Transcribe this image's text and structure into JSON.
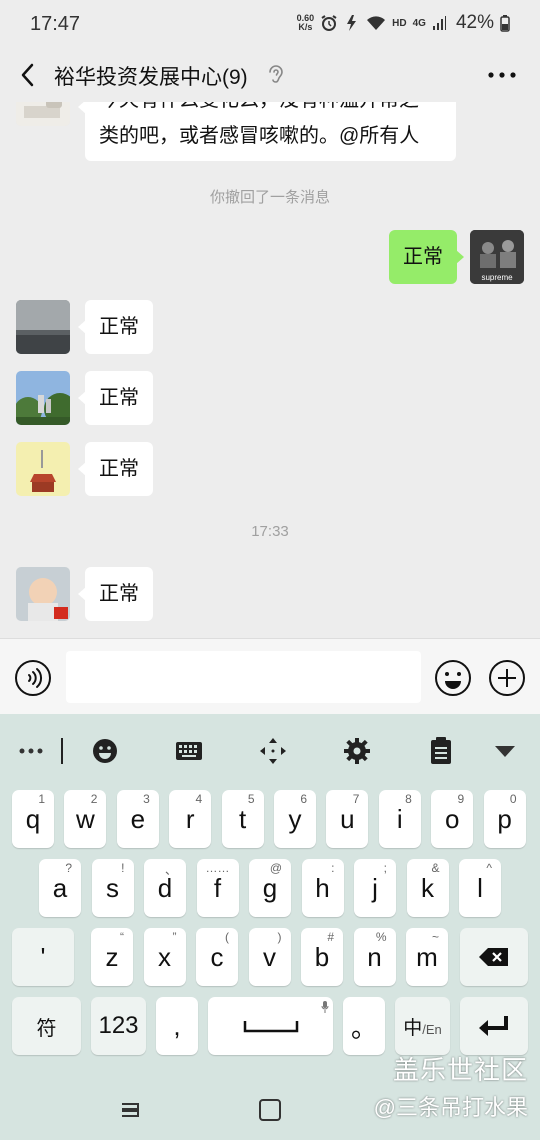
{
  "status_bar": {
    "time": "17:47",
    "net_speed_value": "0.60",
    "net_speed_unit": "K/s",
    "network_label": "HD",
    "signal_label": "4G",
    "battery": "42%"
  },
  "header": {
    "title": "裕华投资发展中心(9)"
  },
  "messages": {
    "partial_line1": "今天有什么变化么，没有种温开帮之",
    "partial_line2": "类的吧，或者感冒咳嗽的。@所有人",
    "recall_notice": "你撤回了一条消息",
    "my_reply": "正常",
    "my_avatar_caption": "supreme",
    "reply1": "正常",
    "reply2": "正常",
    "reply3": "正常",
    "timestamp": "17:33",
    "reply4": "正常"
  },
  "input_bar": {
    "placeholder": ""
  },
  "keyboard": {
    "row1": [
      {
        "key": "q",
        "sub": "1"
      },
      {
        "key": "w",
        "sub": "2"
      },
      {
        "key": "e",
        "sub": "3"
      },
      {
        "key": "r",
        "sub": "4"
      },
      {
        "key": "t",
        "sub": "5"
      },
      {
        "key": "y",
        "sub": "6"
      },
      {
        "key": "u",
        "sub": "7"
      },
      {
        "key": "i",
        "sub": "8"
      },
      {
        "key": "o",
        "sub": "9"
      },
      {
        "key": "p",
        "sub": "0"
      }
    ],
    "row2": [
      {
        "key": "a",
        "sub": "?"
      },
      {
        "key": "s",
        "sub": "!"
      },
      {
        "key": "d",
        "sub": "、"
      },
      {
        "key": "f",
        "sub": "……"
      },
      {
        "key": "g",
        "sub": "@"
      },
      {
        "key": "h",
        "sub": ":"
      },
      {
        "key": "j",
        "sub": ";"
      },
      {
        "key": "k",
        "sub": "&"
      },
      {
        "key": "l",
        "sub": "^"
      }
    ],
    "row3": [
      {
        "key": "'",
        "sub": ""
      },
      {
        "key": "z",
        "sub": "“"
      },
      {
        "key": "x",
        "sub": "”"
      },
      {
        "key": "c",
        "sub": "("
      },
      {
        "key": "v",
        "sub": ")"
      },
      {
        "key": "b",
        "sub": "#"
      },
      {
        "key": "n",
        "sub": "%"
      },
      {
        "key": "m",
        "sub": "~"
      }
    ],
    "symbol_key": "符",
    "number_key": "123",
    "comma_key": ",",
    "period_key": "。",
    "lang_key_main": "中",
    "lang_key_sub": "/En"
  },
  "watermark": {
    "line1": "盖乐世社区",
    "line2": "@三条吊打水果"
  },
  "colors": {
    "chat_bg": "#ededed",
    "my_bubble": "#95ec69",
    "keyboard_bg": "#d6e4e0"
  }
}
